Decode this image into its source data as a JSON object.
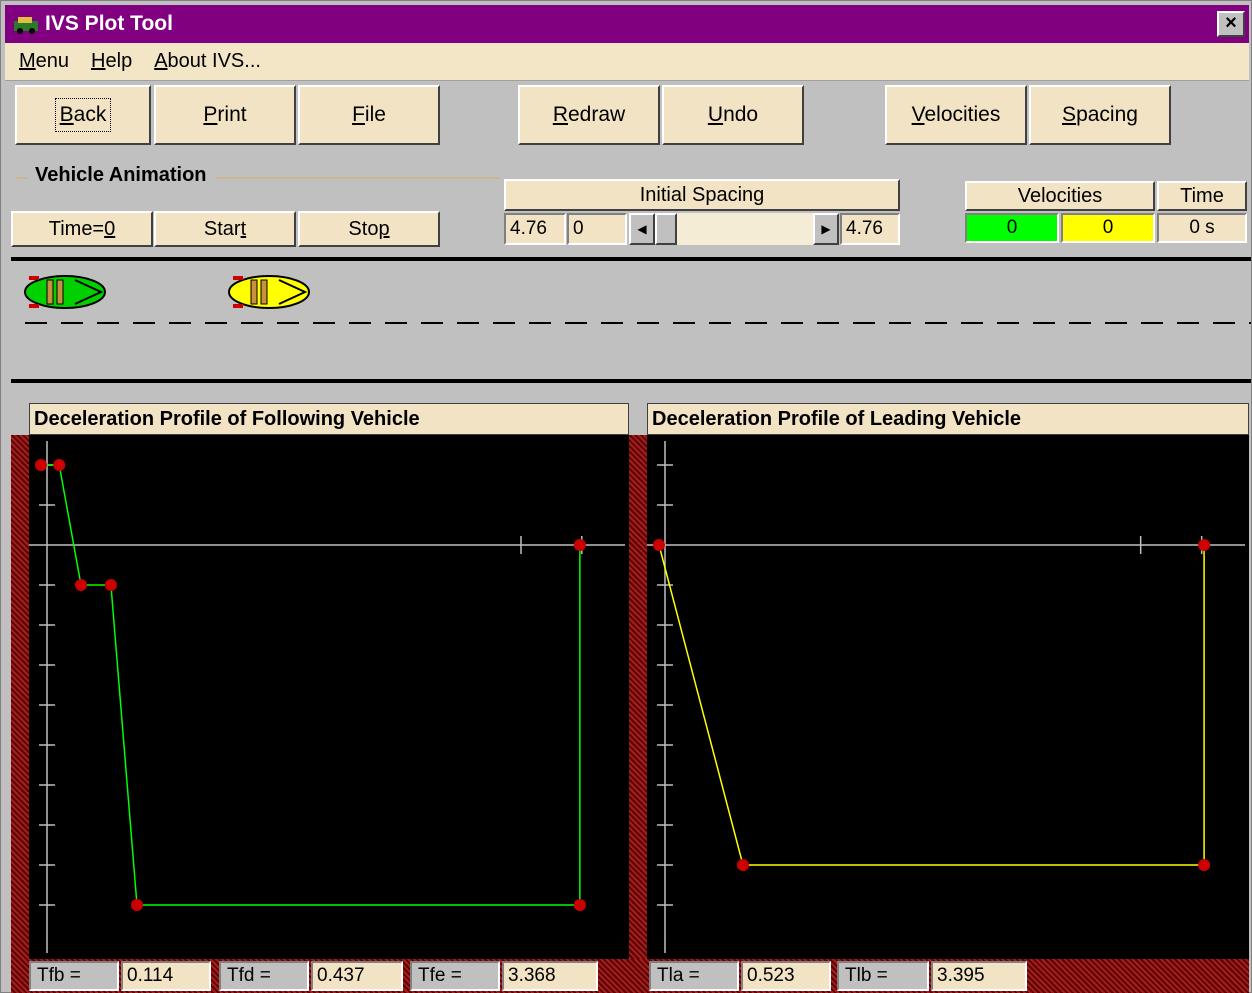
{
  "window": {
    "title": "IVS Plot Tool",
    "close_label": "×"
  },
  "menu": [
    {
      "pre": "",
      "u": "M",
      "post": "enu"
    },
    {
      "pre": "",
      "u": "H",
      "post": "elp"
    },
    {
      "pre": "",
      "u": "A",
      "post": "bout IVS..."
    }
  ],
  "toolbar": {
    "back": {
      "u": "B",
      "post": "ack"
    },
    "print": {
      "u": "P",
      "post": "rint"
    },
    "file": {
      "u": "F",
      "post": "ile"
    },
    "redraw": {
      "u": "R",
      "post": "edraw"
    },
    "undo": {
      "u": "U",
      "post": "ndo"
    },
    "velocities": {
      "u": "V",
      "post": "elocities"
    },
    "spacing": {
      "u": "S",
      "post": "pacing"
    }
  },
  "animation": {
    "group_title": "Vehicle Animation",
    "time0_pre": "Time=",
    "time0_u": "0",
    "start_pre": "Star",
    "start_u": "t",
    "stop_pre": "Sto",
    "stop_u": "p"
  },
  "spacing": {
    "label": "Initial Spacing",
    "min": "4.76",
    "value": "0",
    "max": "4.76",
    "slider_level": 0
  },
  "status": {
    "velocities_label": "Velocities",
    "time_label": "Time",
    "vel_following": "0",
    "vel_leading": "0",
    "time_value": "0 s",
    "color_following": "#00ff00",
    "color_leading": "#ffff00"
  },
  "panels": {
    "following_title": "Deceleration Profile of Following Vehicle",
    "leading_title": "Deceleration Profile of Leading Vehicle"
  },
  "params_following": [
    {
      "label": "Tfb =",
      "value": "0.114"
    },
    {
      "label": "Tfd =",
      "value": "0.437"
    },
    {
      "label": "Tfe =",
      "value": "3.368"
    }
  ],
  "params_leading": [
    {
      "label": "Tla =",
      "value": "0.523"
    },
    {
      "label": "Tlb =",
      "value": "3.395"
    }
  ],
  "chart_data": [
    {
      "type": "line",
      "color": "#00ff00",
      "point_color": "#cc0000",
      "points": [
        [
          0,
          2
        ],
        [
          0.114,
          2
        ],
        [
          0.25,
          -1
        ],
        [
          0.437,
          -1
        ],
        [
          0.6,
          -9
        ],
        [
          3.368,
          -9
        ],
        [
          3.368,
          0
        ]
      ],
      "xlim": [
        0,
        3.6
      ],
      "ylim": [
        -9.5,
        2.5
      ],
      "grid": false
    },
    {
      "type": "line",
      "color": "#ffff00",
      "point_color": "#cc0000",
      "points": [
        [
          0,
          0
        ],
        [
          0.523,
          -8
        ],
        [
          3.395,
          -8
        ],
        [
          3.395,
          0
        ]
      ],
      "xlim": [
        0,
        3.6
      ],
      "ylim": [
        -9.5,
        2.5
      ],
      "grid": false
    }
  ]
}
